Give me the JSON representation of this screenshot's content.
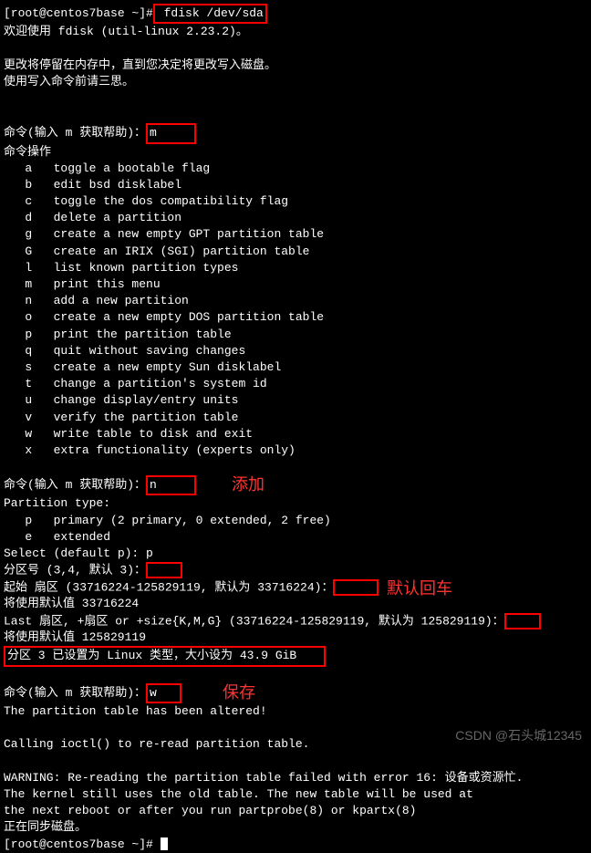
{
  "prompt": "[root@centos7base ~]#",
  "cmd1": " fdisk /dev/sda",
  "welcome": "欢迎使用 fdisk (util-linux 2.23.2)。",
  "warn1": "更改将停留在内存中，直到您决定将更改写入磁盘。",
  "warn2": "使用写入命令前请三思。",
  "cmdPrompt": "命令(输入 m 获取帮助)：",
  "inputM": "m",
  "cmdOpTitle": "命令操作",
  "ops": [
    {
      "k": "a",
      "d": "toggle a bootable flag"
    },
    {
      "k": "b",
      "d": "edit bsd disklabel"
    },
    {
      "k": "c",
      "d": "toggle the dos compatibility flag"
    },
    {
      "k": "d",
      "d": "delete a partition"
    },
    {
      "k": "g",
      "d": "create a new empty GPT partition table"
    },
    {
      "k": "G",
      "d": "create an IRIX (SGI) partition table"
    },
    {
      "k": "l",
      "d": "list known partition types"
    },
    {
      "k": "m",
      "d": "print this menu"
    },
    {
      "k": "n",
      "d": "add a new partition"
    },
    {
      "k": "o",
      "d": "create a new empty DOS partition table"
    },
    {
      "k": "p",
      "d": "print the partition table"
    },
    {
      "k": "q",
      "d": "quit without saving changes"
    },
    {
      "k": "s",
      "d": "create a new empty Sun disklabel"
    },
    {
      "k": "t",
      "d": "change a partition's system id"
    },
    {
      "k": "u",
      "d": "change display/entry units"
    },
    {
      "k": "v",
      "d": "verify the partition table"
    },
    {
      "k": "w",
      "d": "write table to disk and exit"
    },
    {
      "k": "x",
      "d": "extra functionality (experts only)"
    }
  ],
  "inputN": "n",
  "annAdd": "添加",
  "partTypeTitle": "Partition type:",
  "ptP": "   p   primary (2 primary, 0 extended, 2 free)",
  "ptE": "   e   extended",
  "selDef": "Select (default p): p",
  "partNum": "分区号 (3,4, 默认 3)：",
  "startSector": "起始 扇区 (33716224-125829119, 默认为 33716224)：",
  "annEnter": "默认回车",
  "useDefault1": "将使用默认值 33716224",
  "lastSector": "Last 扇区, +扇区 or +size{K,M,G} (33716224-125829119, 默认为 125829119)：",
  "useDefault2": "将使用默认值 125829119",
  "partSet": "分区 3 已设置为 Linux 类型，大小设为 43.9 GiB",
  "inputW": "w",
  "annSave": "保存",
  "altered": "The partition table has been altered!",
  "ioctl": "Calling ioctl() to re-read partition table.",
  "warnFail": "WARNING: Re-reading the partition table failed with error 16: 设备或资源忙.",
  "kernel1": "The kernel still uses the old table. The new table will be used at",
  "kernel2": "the next reboot or after you run partprobe(8) or kpartx(8)",
  "syncing": "正在同步磁盘。",
  "watermark": "CSDN @石头城12345"
}
